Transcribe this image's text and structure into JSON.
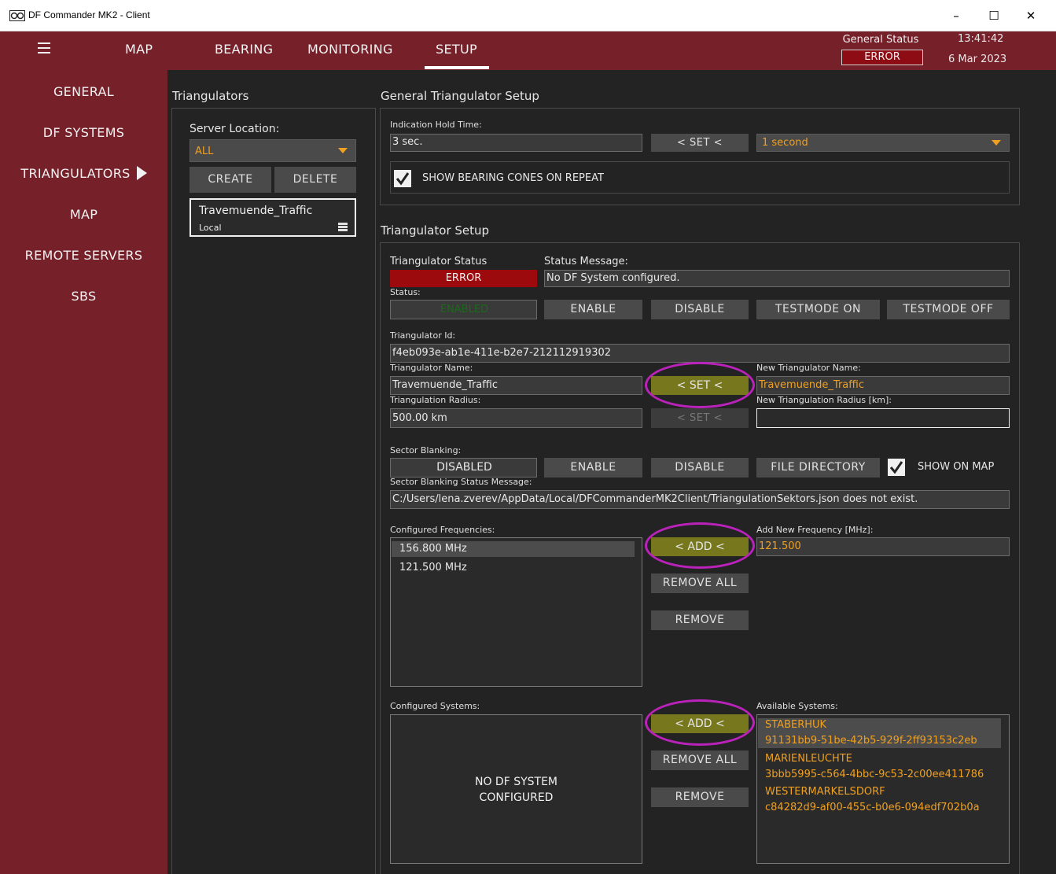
{
  "window": {
    "title": "DF Commander MK2 - Client",
    "minimize": "–",
    "maximize": "☐",
    "close": "✕"
  },
  "nav": {
    "tabs": [
      "MAP",
      "BEARING",
      "MONITORING",
      "SETUP"
    ],
    "general_status_label": "General Status",
    "general_status_value": "ERROR",
    "time": "13:41:42",
    "date": "6 Mar 2023"
  },
  "sidebar": {
    "items": [
      "GENERAL",
      "DF SYSTEMS",
      "TRIANGULATORS",
      "MAP",
      "REMOTE SERVERS",
      "SBS"
    ]
  },
  "triangulators": {
    "title": "Triangulators",
    "server_location_label": "Server Location:",
    "server_location_value": "ALL",
    "create": "CREATE",
    "delete": "DELETE",
    "entry_name": "Travemuende_Traffic",
    "entry_sub": "Local"
  },
  "general_setup": {
    "title": "General Triangulator Setup",
    "hold_time_label": "Indication Hold Time:",
    "hold_time_value": "3 sec.",
    "set": "< SET <",
    "hold_option": "1 second",
    "show_cones": "SHOW BEARING CONES ON REPEAT"
  },
  "setup": {
    "title": "Triangulator Setup",
    "status_label": "Triangulator Status",
    "status_value": "ERROR",
    "status_message_label": "Status Message:",
    "status_message": "No DF System configured.",
    "status2_label": "Status:",
    "status2_value": "ENABLED",
    "enable": "ENABLE",
    "disable": "DISABLE",
    "testmode_on": "TESTMODE ON",
    "testmode_off": "TESTMODE OFF",
    "id_label": "Triangulator Id:",
    "id_value": "f4eb093e-ab1e-411e-b2e7-212112919302",
    "name_label": "Triangulator Name:",
    "name_value": "Travemuende_Traffic",
    "set": "< SET <",
    "new_name_label": "New Triangulator Name:",
    "new_name_value": "Travemuende_Traffic",
    "radius_label": "Triangulation Radius:",
    "radius_value": "500.00 km",
    "new_radius_label": "New Triangulation Radius [km]:",
    "new_radius_value": "",
    "sector_label": "Sector Blanking:",
    "sector_value": "DISABLED",
    "file_directory": "FILE DIRECTORY",
    "show_on_map": "SHOW ON MAP",
    "sector_msg_label": "Sector Blanking Status Message:",
    "sector_msg": "C:/Users/lena.zverev/AppData/Local/DFCommanderMK2Client/TriangulationSektors.json does not exist.",
    "freq_label": "Configured Frequencies:",
    "frequencies": [
      "156.800 MHz",
      "121.500 MHz"
    ],
    "add": "< ADD <",
    "remove_all": "REMOVE ALL",
    "remove": "REMOVE",
    "add_freq_label": "Add New Frequency [MHz]:",
    "add_freq_value": "121.500",
    "systems_label": "Configured Systems:",
    "no_system": "NO DF SYSTEM",
    "no_system2": "CONFIGURED",
    "available_label": "Available Systems:",
    "available": [
      {
        "name": "STABERHUK",
        "id": "91131bb9-51be-42b5-929f-2ff93153c2eb"
      },
      {
        "name": "MARIENLEUCHTE",
        "id": "3bbb5995-c564-4bbc-9c53-2c00ee411786"
      },
      {
        "name": "WESTERMARKELSDORF",
        "id": "c84282d9-af00-455c-b0e6-094edf702b0a"
      }
    ]
  }
}
